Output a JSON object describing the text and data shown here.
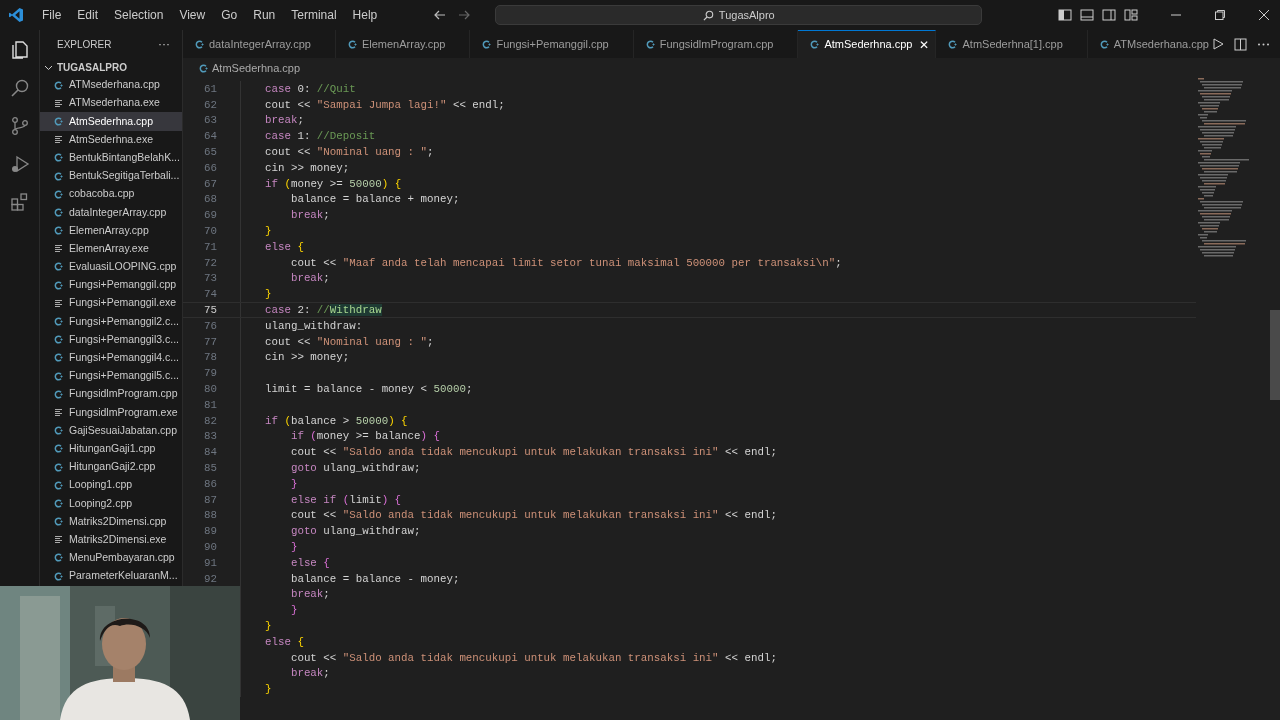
{
  "menu": [
    "File",
    "Edit",
    "Selection",
    "View",
    "Go",
    "Run",
    "Terminal",
    "Help"
  ],
  "search": {
    "value": "TugasAlpro"
  },
  "sidebar": {
    "title": "EXPLORER",
    "more": "···",
    "folder": "TUGASALPRO",
    "expanded": true,
    "files": [
      {
        "name": "ATMsederhana.cpp",
        "kind": "cpp",
        "selected": false
      },
      {
        "name": "ATMsederhana.exe",
        "kind": "exe",
        "selected": false
      },
      {
        "name": "AtmSederhna.cpp",
        "kind": "cpp",
        "selected": true
      },
      {
        "name": "AtmSederhna.exe",
        "kind": "exe",
        "selected": false
      },
      {
        "name": "BentukBintangBelahK...",
        "kind": "cpp",
        "selected": false
      },
      {
        "name": "BentukSegitigaTerbali...",
        "kind": "cpp",
        "selected": false
      },
      {
        "name": "cobacoba.cpp",
        "kind": "cpp",
        "selected": false
      },
      {
        "name": "dataIntegerArray.cpp",
        "kind": "cpp",
        "selected": false
      },
      {
        "name": "ElemenArray.cpp",
        "kind": "cpp",
        "selected": false
      },
      {
        "name": "ElemenArray.exe",
        "kind": "exe",
        "selected": false
      },
      {
        "name": "EvaluasiLOOPING.cpp",
        "kind": "cpp",
        "selected": false
      },
      {
        "name": "Fungsi+Pemanggil.cpp",
        "kind": "cpp",
        "selected": false
      },
      {
        "name": "Fungsi+Pemanggil.exe",
        "kind": "exe",
        "selected": false
      },
      {
        "name": "Fungsi+Pemanggil2.c...",
        "kind": "cpp",
        "selected": false
      },
      {
        "name": "Fungsi+Pemanggil3.c...",
        "kind": "cpp",
        "selected": false
      },
      {
        "name": "Fungsi+Pemanggil4.c...",
        "kind": "cpp",
        "selected": false
      },
      {
        "name": "Fungsi+Pemanggil5.c...",
        "kind": "cpp",
        "selected": false
      },
      {
        "name": "FungsidlmProgram.cpp",
        "kind": "cpp",
        "selected": false
      },
      {
        "name": "FungsidlmProgram.exe",
        "kind": "exe",
        "selected": false
      },
      {
        "name": "GajiSesuaiJabatan.cpp",
        "kind": "cpp",
        "selected": false
      },
      {
        "name": "HitunganGaji1.cpp",
        "kind": "cpp",
        "selected": false
      },
      {
        "name": "HitunganGaji2.cpp",
        "kind": "cpp",
        "selected": false
      },
      {
        "name": "Looping1.cpp",
        "kind": "cpp",
        "selected": false
      },
      {
        "name": "Looping2.cpp",
        "kind": "cpp",
        "selected": false
      },
      {
        "name": "Matriks2Dimensi.cpp",
        "kind": "cpp",
        "selected": false
      },
      {
        "name": "Matriks2Dimensi.exe",
        "kind": "exe",
        "selected": false
      },
      {
        "name": "MenuPembayaran.cpp",
        "kind": "cpp",
        "selected": false
      },
      {
        "name": "ParameterKeluaranM...",
        "kind": "cpp",
        "selected": false
      }
    ]
  },
  "tabs": [
    {
      "label": "dataIntegerArray.cpp",
      "selected": false
    },
    {
      "label": "ElemenArray.cpp",
      "selected": false
    },
    {
      "label": "Fungsi+Pemanggil.cpp",
      "selected": false
    },
    {
      "label": "FungsidlmProgram.cpp",
      "selected": false
    },
    {
      "label": "AtmSederhna.cpp",
      "selected": true,
      "close": "✕"
    },
    {
      "label": "AtmSederhna[1].cpp",
      "selected": false
    },
    {
      "label": "ATMsederhana.cpp",
      "selected": false
    }
  ],
  "breadcrumb": "AtmSederhna.cpp",
  "code": [
    {
      "number": "61",
      "tokens": [
        {
          "kind": "kw",
          "text": "case"
        },
        {
          "kind": "txt",
          "text": " 0: "
        },
        {
          "kind": "com",
          "text": "//Quit"
        }
      ]
    },
    {
      "number": "62",
      "tokens": [
        {
          "kind": "txt",
          "text": "cout << "
        },
        {
          "kind": "str",
          "text": "\"Sampai Jumpa lagi!\""
        },
        {
          "kind": "txt",
          "text": " << endl;"
        }
      ]
    },
    {
      "number": "63",
      "tokens": [
        {
          "kind": "kw",
          "text": "break"
        },
        {
          "kind": "txt",
          "text": ";"
        }
      ]
    },
    {
      "number": "64",
      "tokens": [
        {
          "kind": "kw",
          "text": "case"
        },
        {
          "kind": "txt",
          "text": " 1: "
        },
        {
          "kind": "com",
          "text": "//Deposit"
        }
      ]
    },
    {
      "number": "65",
      "tokens": [
        {
          "kind": "txt",
          "text": "cout << "
        },
        {
          "kind": "str",
          "text": "\"Nominal uang : \""
        },
        {
          "kind": "txt",
          "text": ";"
        }
      ]
    },
    {
      "number": "66",
      "tokens": [
        {
          "kind": "txt",
          "text": "cin >> money;"
        }
      ]
    },
    {
      "number": "67",
      "tokens": [
        {
          "kind": "kw",
          "text": "if"
        },
        {
          "kind": "br1",
          "text": " ("
        },
        {
          "kind": "txt",
          "text": "money >= "
        },
        {
          "kind": "num",
          "text": "50000"
        },
        {
          "kind": "br1",
          "text": ")"
        },
        {
          "kind": "br1",
          "text": " {"
        }
      ]
    },
    {
      "number": "68",
      "tokens": [
        {
          "kind": "txt",
          "text": "    balance = balance + money;"
        }
      ]
    },
    {
      "number": "69",
      "tokens": [
        {
          "kind": "kw",
          "text": "    break"
        },
        {
          "kind": "txt",
          "text": ";"
        }
      ]
    },
    {
      "number": "70",
      "tokens": [
        {
          "kind": "br1",
          "text": "}"
        }
      ]
    },
    {
      "number": "71",
      "tokens": [
        {
          "kind": "kw",
          "text": "else"
        },
        {
          "kind": "br1",
          "text": " {"
        }
      ]
    },
    {
      "number": "72",
      "tokens": [
        {
          "kind": "txt",
          "text": "    cout << "
        },
        {
          "kind": "str",
          "text": "\"Maaf anda telah mencapai limit setor tunai maksimal 500000 per transaksi\\n\""
        },
        {
          "kind": "txt",
          "text": ";"
        }
      ]
    },
    {
      "number": "73",
      "tokens": [
        {
          "kind": "kw",
          "text": "    break"
        },
        {
          "kind": "txt",
          "text": ";"
        }
      ]
    },
    {
      "number": "74",
      "tokens": [
        {
          "kind": "br1",
          "text": "}"
        }
      ]
    },
    {
      "number": "75",
      "current": true,
      "tokens": [
        {
          "kind": "kw",
          "text": "case"
        },
        {
          "kind": "txt",
          "text": " 2: "
        },
        {
          "kind": "com",
          "text": "//"
        },
        {
          "kind": "com",
          "text": "Withdraw",
          "highlighted": true
        }
      ]
    },
    {
      "number": "76",
      "tokens": [
        {
          "kind": "txt",
          "text": "ulang_withdraw:"
        }
      ]
    },
    {
      "number": "77",
      "tokens": [
        {
          "kind": "txt",
          "text": "cout << "
        },
        {
          "kind": "str",
          "text": "\"Nominal uang : \""
        },
        {
          "kind": "txt",
          "text": ";"
        }
      ]
    },
    {
      "number": "78",
      "tokens": [
        {
          "kind": "txt",
          "text": "cin >> money;"
        }
      ]
    },
    {
      "number": "79"
    },
    {
      "number": "80",
      "tokens": [
        {
          "kind": "txt",
          "text": "limit = balance - money < "
        },
        {
          "kind": "num",
          "text": "50000"
        },
        {
          "kind": "txt",
          "text": ";"
        }
      ]
    },
    {
      "number": "81"
    },
    {
      "number": "82",
      "tokens": [
        {
          "kind": "kw",
          "text": "if"
        },
        {
          "kind": "br1",
          "text": " ("
        },
        {
          "kind": "txt",
          "text": "balance > "
        },
        {
          "kind": "num",
          "text": "50000"
        },
        {
          "kind": "br1",
          "text": ")"
        },
        {
          "kind": "br1",
          "text": " {"
        }
      ]
    },
    {
      "number": "83",
      "tokens": [
        {
          "kind": "kw",
          "text": "    if"
        },
        {
          "kind": "br2",
          "text": " ("
        },
        {
          "kind": "txt",
          "text": "money >= balance"
        },
        {
          "kind": "br2",
          "text": ")"
        },
        {
          "kind": "br2",
          "text": " {"
        }
      ]
    },
    {
      "number": "84",
      "tokens": [
        {
          "kind": "txt",
          "text": "    cout << "
        },
        {
          "kind": "str",
          "text": "\"Saldo anda tidak mencukupi untuk melakukan transaksi ini\""
        },
        {
          "kind": "txt",
          "text": " << endl;"
        }
      ]
    },
    {
      "number": "85",
      "tokens": [
        {
          "kind": "kw",
          "text": "    goto"
        },
        {
          "kind": "txt",
          "text": " ulang_withdraw;"
        }
      ]
    },
    {
      "number": "86",
      "tokens": [
        {
          "kind": "br2",
          "text": "    }"
        }
      ]
    },
    {
      "number": "87",
      "tokens": [
        {
          "kind": "kw",
          "text": "    else if"
        },
        {
          "kind": "br2",
          "text": " ("
        },
        {
          "kind": "txt",
          "text": "limit"
        },
        {
          "kind": "br2",
          "text": ")"
        },
        {
          "kind": "br2",
          "text": " {"
        }
      ]
    },
    {
      "number": "88",
      "tokens": [
        {
          "kind": "txt",
          "text": "    cout << "
        },
        {
          "kind": "str",
          "text": "\"Saldo anda tidak mencukupi untuk melakukan transaksi ini\""
        },
        {
          "kind": "txt",
          "text": " << endl;"
        }
      ]
    },
    {
      "number": "89",
      "tokens": [
        {
          "kind": "kw",
          "text": "    goto"
        },
        {
          "kind": "txt",
          "text": " ulang_withdraw;"
        }
      ]
    },
    {
      "number": "90",
      "tokens": [
        {
          "kind": "br2",
          "text": "    }"
        }
      ]
    },
    {
      "number": "91",
      "tokens": [
        {
          "kind": "kw",
          "text": "    else"
        },
        {
          "kind": "br2",
          "text": " {"
        }
      ]
    },
    {
      "number": "92",
      "tokens": [
        {
          "kind": "txt",
          "text": "    balance = balance - money;"
        }
      ]
    },
    {
      "tokens": [
        {
          "kind": "kw",
          "text": "    break"
        },
        {
          "kind": "txt",
          "text": ";"
        }
      ]
    },
    {
      "tokens": [
        {
          "kind": "br2",
          "text": "    }"
        }
      ]
    },
    {
      "tokens": [
        {
          "kind": "br1",
          "text": "}"
        }
      ]
    },
    {
      "tokens": [
        {
          "kind": "kw",
          "text": "else"
        },
        {
          "kind": "br1",
          "text": " {"
        }
      ]
    },
    {
      "tokens": [
        {
          "kind": "txt",
          "text": "    cout << "
        },
        {
          "kind": "str",
          "text": "\"Saldo anda tidak mencukupi untuk melakukan transaksi ini\""
        },
        {
          "kind": "txt",
          "text": " << endl;"
        }
      ]
    },
    {
      "tokens": [
        {
          "kind": "kw",
          "text": "    break"
        },
        {
          "kind": "txt",
          "text": ";"
        }
      ]
    },
    {
      "tokens": [
        {
          "kind": "br1",
          "text": "}"
        }
      ]
    }
  ]
}
